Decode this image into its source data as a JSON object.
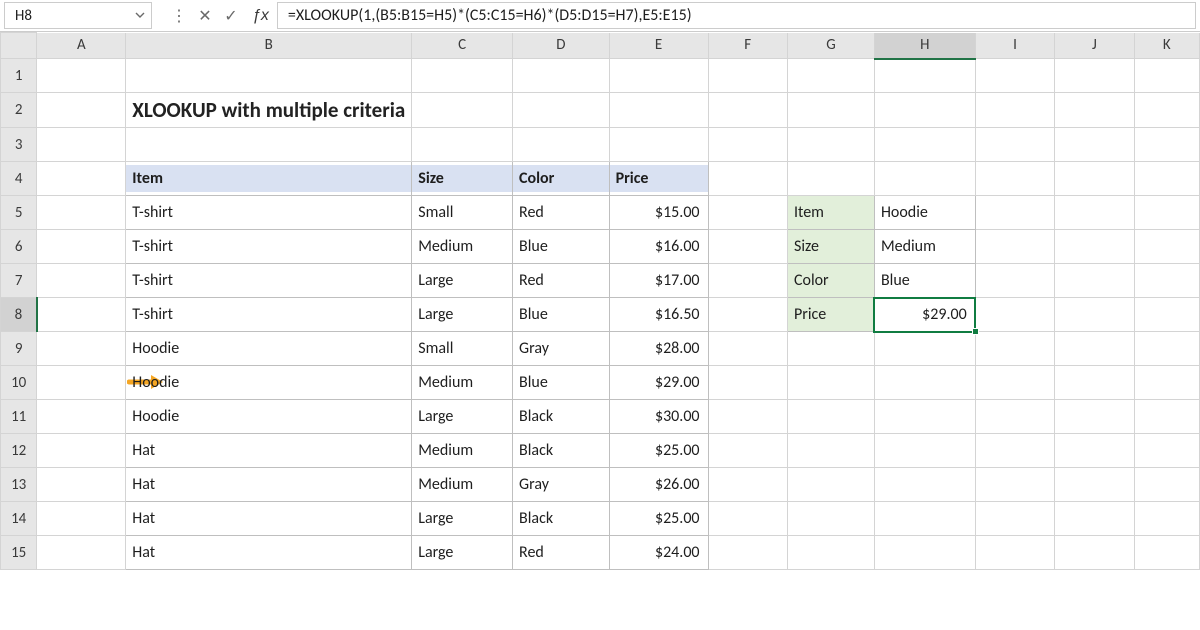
{
  "namebox": "H8",
  "formula": "=XLOOKUP(1,(B5:B15=H5)*(C5:C15=H6)*(D5:D15=H7),E5:E15)",
  "title": "XLOOKUP with multiple criteria",
  "columns": [
    "A",
    "B",
    "C",
    "D",
    "E",
    "F",
    "G",
    "H",
    "I",
    "J",
    "K"
  ],
  "row_count": 15,
  "selected_col": "H",
  "selected_row": 8,
  "table": {
    "headers": [
      "Item",
      "Size",
      "Color",
      "Price"
    ],
    "rows": [
      {
        "item": "T-shirt",
        "size": "Small",
        "color": "Red",
        "price": "$15.00"
      },
      {
        "item": "T-shirt",
        "size": "Medium",
        "color": "Blue",
        "price": "$16.00"
      },
      {
        "item": "T-shirt",
        "size": "Large",
        "color": "Red",
        "price": "$17.00"
      },
      {
        "item": "T-shirt",
        "size": "Large",
        "color": "Blue",
        "price": "$16.50"
      },
      {
        "item": "Hoodie",
        "size": "Small",
        "color": "Gray",
        "price": "$28.00"
      },
      {
        "item": "Hoodie",
        "size": "Medium",
        "color": "Blue",
        "price": "$29.00"
      },
      {
        "item": "Hoodie",
        "size": "Large",
        "color": "Black",
        "price": "$30.00"
      },
      {
        "item": "Hat",
        "size": "Medium",
        "color": "Black",
        "price": "$25.00"
      },
      {
        "item": "Hat",
        "size": "Medium",
        "color": "Gray",
        "price": "$26.00"
      },
      {
        "item": "Hat",
        "size": "Large",
        "color": "Black",
        "price": "$25.00"
      },
      {
        "item": "Hat",
        "size": "Large",
        "color": "Red",
        "price": "$24.00"
      }
    ]
  },
  "lookup": {
    "labels": [
      "Item",
      "Size",
      "Color",
      "Price"
    ],
    "values": [
      "Hoodie",
      "Medium",
      "Blue",
      "$29.00"
    ]
  },
  "arrow_row": 10
}
